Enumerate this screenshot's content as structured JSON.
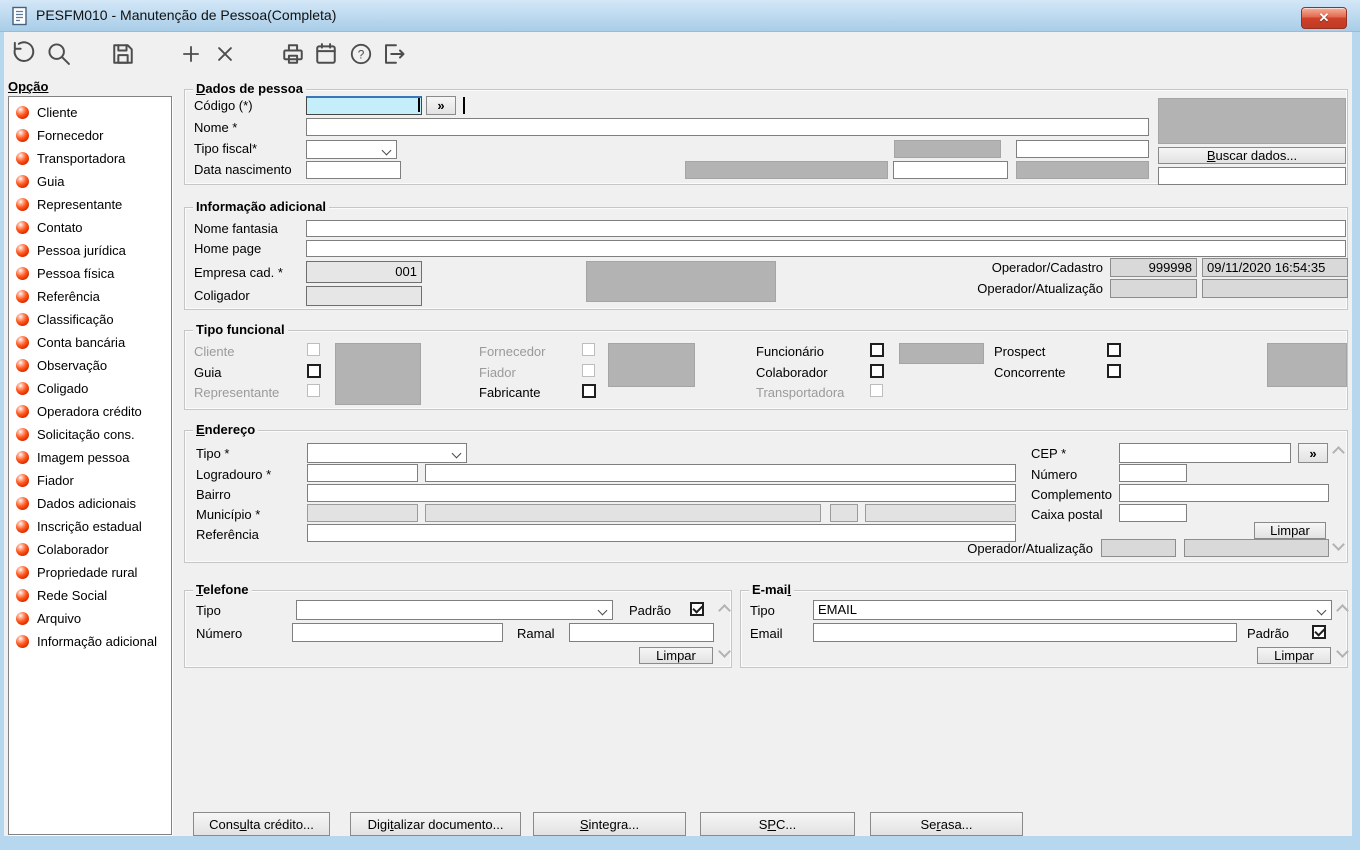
{
  "window": {
    "title": "PESFM010 - Manutenção de Pessoa(Completa)",
    "close_icon": "✕"
  },
  "toolbar": {
    "icons": [
      "undo-icon",
      "search-icon",
      "save-icon",
      "add-icon",
      "delete-icon",
      "print-icon",
      "calendar-icon",
      "help-icon",
      "exit-icon"
    ]
  },
  "sidebar": {
    "header": "Opção",
    "bullet_icon": "red-sphere-bullet",
    "items": [
      "Cliente",
      "Fornecedor",
      "Transportadora",
      "Guia",
      "Representante",
      "Contato",
      "Pessoa jurídica",
      "Pessoa física",
      "Referência",
      "Classificação",
      "Conta bancária",
      "Observação",
      "Coligado",
      "Operadora crédito",
      "Solicitação cons.",
      "Imagem pessoa",
      "Fiador",
      "Dados adicionais",
      "Inscrição estadual",
      "Colaborador",
      "Propriedade rural",
      "Rede Social",
      "Arquivo",
      "Informação adicional"
    ]
  },
  "dados_pessoa": {
    "title": "Dados de pessoa",
    "codigo_label": "Código (*)",
    "codigo_value": "",
    "expand_button": "»",
    "nome_label": "Nome *",
    "nome_value": "",
    "tipo_fiscal_label": "Tipo fiscal*",
    "tipo_fiscal_value": "",
    "data_nascimento_label": "Data nascimento",
    "data_nascimento_value": "",
    "buscar_dados_button": "Buscar dados..."
  },
  "informacao_adicional": {
    "title": "Informação adicional",
    "nome_fantasia_label": "Nome fantasia",
    "home_page_label": "Home page",
    "empresa_cad_label": "Empresa cad. *",
    "empresa_cad_value": "001",
    "coligador_label": "Coligador",
    "coligador_value": "",
    "operador_cadastro_label": "Operador/Cadastro",
    "operador_cadastro_codigo": "999998",
    "operador_cadastro_datahora": "09/11/2020 16:54:35",
    "operador_atualizacao_label": "Operador/Atualização",
    "operador_atualizacao_codigo": "",
    "operador_atualizacao_datahora": ""
  },
  "tipo_funcional": {
    "title": "Tipo funcional",
    "columns": [
      [
        {
          "label": "Cliente",
          "enabled": false,
          "checked": false
        },
        {
          "label": "Guia",
          "enabled": true,
          "checked": false
        },
        {
          "label": "Representante",
          "enabled": false,
          "checked": false
        }
      ],
      [
        {
          "label": "Fornecedor",
          "enabled": false,
          "checked": false
        },
        {
          "label": "Fiador",
          "enabled": false,
          "checked": false
        },
        {
          "label": "Fabricante",
          "enabled": true,
          "checked": false
        }
      ],
      [
        {
          "label": "Funcionário",
          "enabled": true,
          "checked": false
        },
        {
          "label": "Colaborador",
          "enabled": true,
          "checked": false
        },
        {
          "label": "Transportadora",
          "enabled": false,
          "checked": false
        }
      ],
      [
        {
          "label": "Prospect",
          "enabled": true,
          "checked": false
        },
        {
          "label": "Concorrente",
          "enabled": true,
          "checked": false
        }
      ]
    ]
  },
  "endereco": {
    "title": "Endereço",
    "tipo_label": "Tipo *",
    "tipo_value": "",
    "logradouro_label": "Logradouro *",
    "bairro_label": "Bairro",
    "municipio_label": "Município *",
    "referencia_label": "Referência",
    "cep_label": "CEP *",
    "cep_value": "",
    "cep_expand_button": "»",
    "numero_label": "Número",
    "complemento_label": "Complemento",
    "caixa_postal_label": "Caixa postal",
    "limpar_button": "Limpar",
    "operador_atualizacao_label": "Operador/Atualização"
  },
  "telefone": {
    "title": "Telefone",
    "tipo_label": "Tipo",
    "tipo_value": "",
    "padrao_label": "Padrão",
    "padrao_checked": true,
    "numero_label": "Número",
    "numero_value": "",
    "ramal_label": "Ramal",
    "ramal_value": "",
    "limpar_button": "Limpar"
  },
  "email": {
    "title": "E-mail",
    "tipo_label": "Tipo",
    "tipo_value": "EMAIL",
    "email_label": "Email",
    "email_value": "",
    "padrao_label": "Padrão",
    "padrao_checked": true,
    "limpar_button": "Limpar"
  },
  "footer_buttons": [
    "Consulta crédito...",
    "Digitalizar documento...",
    "Sintegra...",
    "SPC...",
    "Serasa..."
  ]
}
